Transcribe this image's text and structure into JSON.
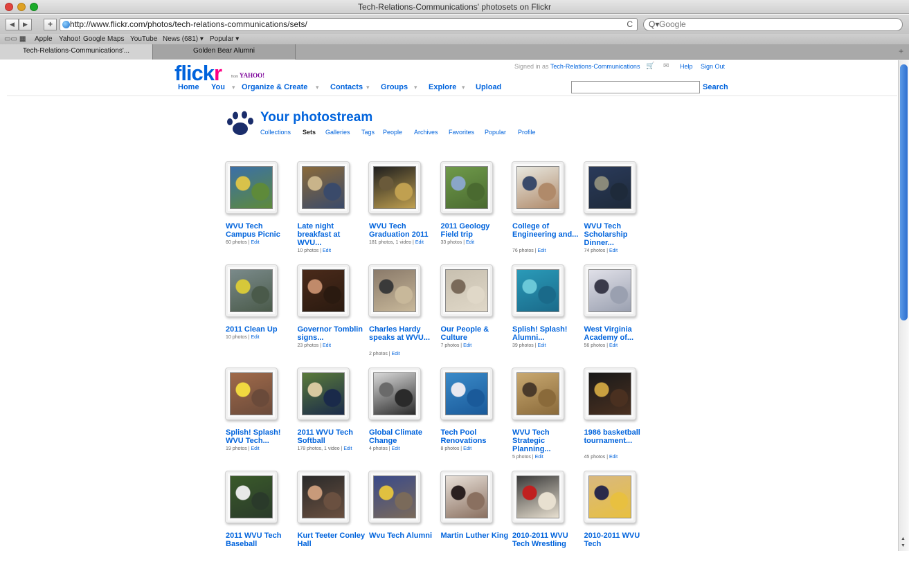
{
  "window": {
    "title": "Tech-Relations-Communications' photosets on Flickr"
  },
  "toolbar": {
    "back": "◀",
    "forward": "▶",
    "add": "+",
    "url": "http://www.flickr.com/photos/tech-relations-communications/sets/",
    "reload": "C",
    "search_placeholder": "Google"
  },
  "bookmarks": {
    "items": [
      "Apple",
      "Yahoo!",
      "Google Maps",
      "YouTube",
      "News (681) ▾",
      "Popular ▾"
    ]
  },
  "tabs": {
    "items": [
      {
        "label": "Tech-Relations-Communications'..."
      },
      {
        "label": "Golden Bear Alumni"
      }
    ],
    "plus": "+"
  },
  "header": {
    "logo_main": "flick",
    "logo_r": "r",
    "from_label": "from",
    "from_brand": "YAHOO!",
    "signed_in_prefix": "Signed in as",
    "user": "Tech-Relations-Communications",
    "help": "Help",
    "signout": "Sign Out",
    "nav": {
      "home": "Home",
      "you": "You",
      "organize": "Organize & Create",
      "contacts": "Contacts",
      "groups": "Groups",
      "explore": "Explore",
      "upload": "Upload"
    },
    "search_button": "Search",
    "search_value": ""
  },
  "photostream": {
    "title": "Your photostream",
    "subnav": {
      "collections": "Collections",
      "sets": "Sets",
      "galleries": "Galleries",
      "tags": "Tags",
      "people": "People",
      "archives": "Archives",
      "favorites": "Favorites",
      "popular": "Popular",
      "profile": "Profile"
    }
  },
  "edit_label": "Edit",
  "sets": [
    {
      "title": "WVU Tech Campus Picnic",
      "count": "60 photos |",
      "colors": [
        "#3a6fa8",
        "#d8c24a",
        "#5e8a3a"
      ]
    },
    {
      "title": "Late night breakfast at WVU...",
      "count": "10 photos |",
      "colors": [
        "#8a6a3a",
        "#c9b48a",
        "#3a4a6a"
      ]
    },
    {
      "title": "WVU Tech Graduation 2011",
      "count": "181 photos, 1 video |",
      "colors": [
        "#1e1e1e",
        "#6a5a3a",
        "#c0a050"
      ]
    },
    {
      "title": "2011 Geology Field trip",
      "count": "33 photos |",
      "colors": [
        "#6f9a4a",
        "#8aa6c8",
        "#4a6a30"
      ]
    },
    {
      "title": "College of Engineering and...",
      "count": "76 photos |",
      "colors": [
        "#e8e8e0",
        "#3a4a6a",
        "#b08a6a"
      ]
    },
    {
      "title": "WVU Tech Scholarship Dinner...",
      "count": "74 photos |",
      "colors": [
        "#2a3a5a",
        "#8a8a7a",
        "#1e2a3a"
      ]
    },
    {
      "title": "2011 Clean Up",
      "count": "10 photos |",
      "colors": [
        "#7a8a8a",
        "#d6c83a",
        "#4a5a4a"
      ]
    },
    {
      "title": "Governor Tomblin signs...",
      "count": "23 photos |",
      "colors": [
        "#4a2a1a",
        "#c08a6a",
        "#2a1a10"
      ]
    },
    {
      "title": "Charles Hardy speaks at WVU...",
      "count": "2 photos |",
      "colors": [
        "#8a7a6a",
        "#3a3a3a",
        "#c8b89a"
      ]
    },
    {
      "title": "Our People & Culture",
      "count": "7 photos |",
      "colors": [
        "#c8c0b0",
        "#7a6a5a",
        "#e0d8c8"
      ]
    },
    {
      "title": "Splish! Splash! Alumni...",
      "count": "39 photos |",
      "colors": [
        "#2a9ab8",
        "#6ac8d8",
        "#1a6a8a"
      ]
    },
    {
      "title": "West Virginia Academy of...",
      "count": "56 photos |",
      "colors": [
        "#e0e0e8",
        "#3a3a4a",
        "#9aa0b0"
      ]
    },
    {
      "title": "Splish! Splash! WVU Tech...",
      "count": "19 photos |",
      "colors": [
        "#a06a4a",
        "#f0d840",
        "#6a4a3a"
      ]
    },
    {
      "title": "2011 WVU Tech Softball",
      "count": "178 photos, 1 video |",
      "colors": [
        "#5a7a3a",
        "#d8c8a0",
        "#1a2a4a"
      ]
    },
    {
      "title": "Global Climate Change",
      "count": "4 photos |",
      "colors": [
        "#d8d8d8",
        "#6a6a6a",
        "#2a2a2a"
      ]
    },
    {
      "title": "Tech Pool Renovations",
      "count": "8 photos |",
      "colors": [
        "#3a8ac8",
        "#e8e8f0",
        "#1a5a9a"
      ]
    },
    {
      "title": "WVU Tech Strategic Planning...",
      "count": "5 photos |",
      "colors": [
        "#c8a870",
        "#4a3a2a",
        "#8a6a3a"
      ]
    },
    {
      "title": "1986 basketball tournament...",
      "count": "45 photos |",
      "colors": [
        "#1a1a1a",
        "#c8a040",
        "#4a3020"
      ]
    },
    {
      "title": "2011 WVU Tech Baseball",
      "count": "",
      "colors": [
        "#3a5a2a",
        "#e8e8e8",
        "#2a3a2a"
      ]
    },
    {
      "title": "Kurt Teeter Conley Hall",
      "count": "",
      "colors": [
        "#2a2a2a",
        "#c89a7a",
        "#6a5040"
      ]
    },
    {
      "title": "Wvu Tech Alumni",
      "count": "",
      "colors": [
        "#3a4a8a",
        "#e0c040",
        "#7a6a5a"
      ]
    },
    {
      "title": "Martin Luther King",
      "count": "",
      "colors": [
        "#e8e0d8",
        "#2a2020",
        "#8a7060"
      ]
    },
    {
      "title": "2010-2011 WVU Tech Wrestling",
      "count": "",
      "colors": [
        "#3a3a3a",
        "#c02020",
        "#e8e0d0"
      ]
    },
    {
      "title": "2010-2011 WVU Tech",
      "count": "",
      "colors": [
        "#d8b880",
        "#2a2a4a",
        "#e8c040"
      ]
    }
  ]
}
